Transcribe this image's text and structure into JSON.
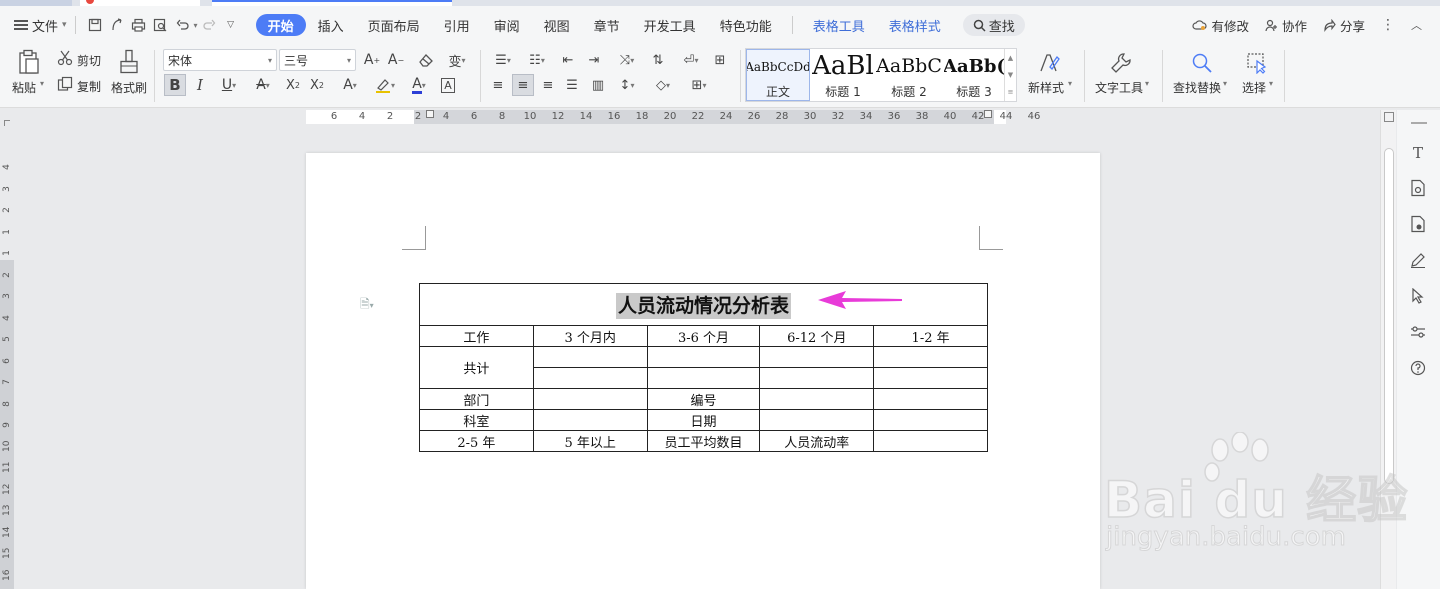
{
  "menubar": {
    "file_label": "文件",
    "tabs": [
      "开始",
      "插入",
      "页面布局",
      "引用",
      "审阅",
      "视图",
      "章节",
      "开发工具",
      "特色功能"
    ],
    "context_tabs": [
      "表格工具",
      "表格样式"
    ],
    "search_label": "查找",
    "right_items": {
      "changes": "有修改",
      "collab": "协作",
      "share": "分享"
    }
  },
  "ribbon": {
    "paste_label": "粘贴",
    "cut_label": "剪切",
    "copy_label": "复制",
    "format_painter_label": "格式刷",
    "font_name": "宋体",
    "font_size": "三号",
    "styles": [
      {
        "preview": "AaBbCcDd",
        "name": "正文"
      },
      {
        "preview": "AaBl",
        "name": "标题 1"
      },
      {
        "preview": "AaBbC",
        "name": "标题 2"
      },
      {
        "preview": "AaBb(",
        "name": "标题 3"
      }
    ],
    "new_style_label": "新样式",
    "text_tools_label": "文字工具",
    "find_replace_label": "查找替换",
    "select_label": "选择"
  },
  "ruler": {
    "h_numbers": [
      "6",
      "4",
      "2",
      "2",
      "4",
      "6",
      "8",
      "10",
      "12",
      "14",
      "16",
      "18",
      "20",
      "22",
      "24",
      "26",
      "28",
      "30",
      "32",
      "34",
      "36",
      "38",
      "40",
      "42",
      "44",
      "46"
    ],
    "v_numbers": [
      "4",
      "3",
      "2",
      "1",
      "1",
      "2",
      "3",
      "4",
      "5",
      "6",
      "7",
      "8",
      "9",
      "10",
      "11",
      "12",
      "13",
      "14",
      "15",
      "16"
    ]
  },
  "document": {
    "table": {
      "title": "人员流动情况分析表",
      "header_row": [
        "工作",
        "3 个月内",
        "3-6 个月",
        "6-12 个月",
        "1-2 年"
      ],
      "total_label": "共计",
      "row_dept": [
        "部门",
        "",
        "编号",
        "",
        ""
      ],
      "row_office": [
        "科室",
        "",
        "日期",
        "",
        ""
      ],
      "row_last": [
        "2-5 年",
        "5 年以上",
        "员工平均数目",
        "人员流动率",
        ""
      ]
    }
  },
  "watermark": {
    "brand": "Bai du 经验",
    "url": "jingyan.baidu.com"
  },
  "colors": {
    "accent": "#4d7cf6",
    "arrow": "#e83bd8",
    "context_tab": "#3f6ed8"
  }
}
